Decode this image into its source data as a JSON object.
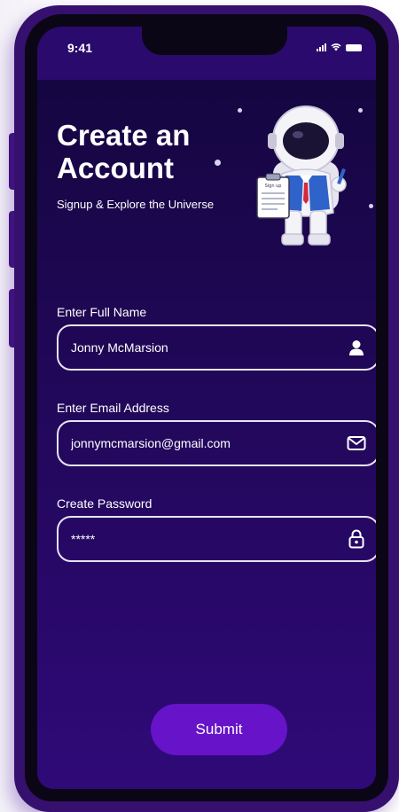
{
  "status_bar": {
    "time": "9:41"
  },
  "header": {
    "title": "Create an Account",
    "subtitle": "Signup & Explore the Universe",
    "illustration": "astronaut-holding-signup-clipboard",
    "clipboard_text": "Sign up"
  },
  "form": {
    "full_name": {
      "label": "Enter Full Name",
      "value": "Jonny McMarsion",
      "icon": "user-icon"
    },
    "email": {
      "label": "Enter Email Address",
      "value": "jonnymcmarsion@gmail.com",
      "icon": "mail-icon"
    },
    "password": {
      "label": "Create Password",
      "value": "*****",
      "icon": "lock-icon"
    },
    "submit_label": "Submit"
  },
  "colors": {
    "background_top": "#12063d",
    "background_bottom": "#2f0a78",
    "phone_frame": "#36106e",
    "button": "#6613c9",
    "field_border": "#e7e3f4"
  }
}
